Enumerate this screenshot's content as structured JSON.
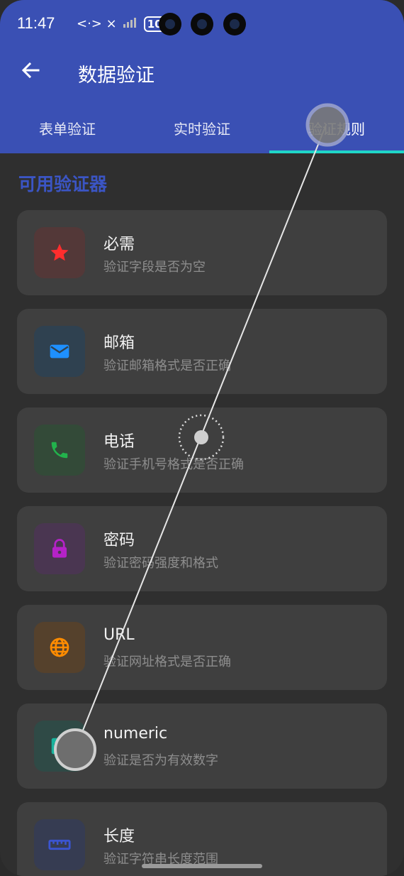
{
  "status_bar": {
    "time": "11:47",
    "signal_text": "<·> ×",
    "battery": "100"
  },
  "toolbar": {
    "title": "数据验证"
  },
  "tabs": [
    {
      "label": "表单验证"
    },
    {
      "label": "实时验证"
    },
    {
      "label": "验证规则",
      "active": true
    }
  ],
  "section": {
    "title": "可用验证器"
  },
  "validators": [
    {
      "title": "必需",
      "desc": "验证字段是否为空",
      "icon": "star-icon",
      "color": "#ff2d2d",
      "bg": "#5a3a3a"
    },
    {
      "title": "邮箱",
      "desc": "验证邮箱格式是否正确",
      "icon": "mail-icon",
      "color": "#1e90ff",
      "bg": "#2f4150"
    },
    {
      "title": "电话",
      "desc": "验证手机号格式是否正确",
      "icon": "phone-icon",
      "color": "#22b24c",
      "bg": "#334a38"
    },
    {
      "title": "密码",
      "desc": "验证密码强度和格式",
      "icon": "lock-icon",
      "color": "#b522c7",
      "bg": "#4a3651"
    },
    {
      "title": "URL",
      "desc": "验证网址格式是否正确",
      "icon": "globe-icon",
      "color": "#ff8c00",
      "bg": "#55412c"
    },
    {
      "title": "numeric",
      "desc": "验证是否为有效数字",
      "icon": "number-icon",
      "color": "#19b39d",
      "bg": "#2f4a46"
    },
    {
      "title": "长度",
      "desc": "验证字符串长度范围",
      "icon": "ruler-icon",
      "color": "#3b55d0",
      "bg": "#363c52"
    }
  ],
  "colors": {
    "appbar": "#3a50b4",
    "accent": "#20d6c8",
    "section_title": "#3b55c4"
  }
}
